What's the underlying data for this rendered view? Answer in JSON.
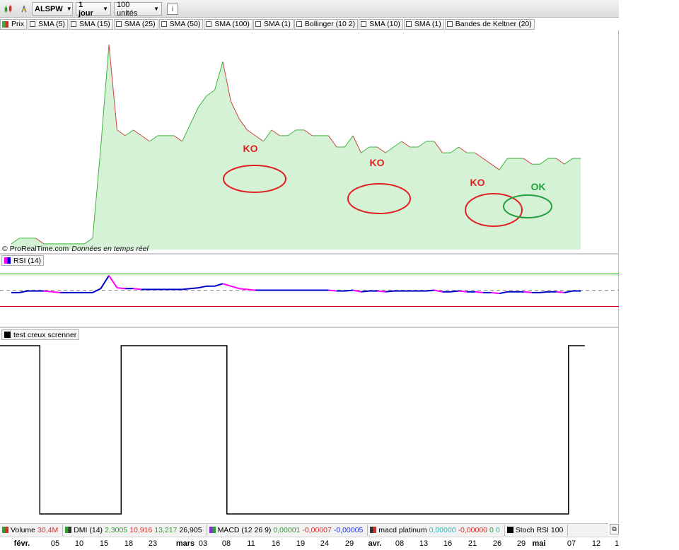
{
  "toolbar": {
    "symbol": "ALSPW",
    "period": "1 jour",
    "units": "100 unités",
    "info_icon": "i"
  },
  "indicators": [
    {
      "label": "Prix",
      "swatch": "#3aa83a"
    },
    {
      "label": "SMA (5)"
    },
    {
      "label": "SMA (15)"
    },
    {
      "label": "SMA (25)"
    },
    {
      "label": "SMA (50)"
    },
    {
      "label": "SMA (100)"
    },
    {
      "label": "SMA (1)"
    },
    {
      "label": "Bollinger (10 2)"
    },
    {
      "label": "SMA (10)"
    },
    {
      "label": "SMA (1)"
    },
    {
      "label": "Bandes de Keltner (20)"
    }
  ],
  "source_note": {
    "brand": "© ProRealTime.com",
    "realtime": "Données en temps réel"
  },
  "rsi_panel": {
    "label": "RSI (14)"
  },
  "test_panel": {
    "label": "test creux screnner"
  },
  "bottom_indicators": {
    "volume": {
      "label": "Volume",
      "value": "30,4M"
    },
    "dmi": {
      "label": "DMI (14)",
      "v1": "2,3005",
      "v2": "10,916",
      "v3": "13,217",
      "v4": "26,905"
    },
    "macd": {
      "label": "MACD (12 26 9)",
      "v1": "0,00001",
      "v2": "-0,00007",
      "v3": "-0,00005"
    },
    "macd_platinum": {
      "label": "macd platinum",
      "v1": "0,00000",
      "v2": "-0,00000",
      "v3": "0",
      "v4": "0"
    },
    "stoch_rsi": {
      "label": "Stoch RSI 100"
    }
  },
  "annotations": [
    {
      "text": "KO",
      "color": "#e02020"
    },
    {
      "text": "KO",
      "color": "#e02020"
    },
    {
      "text": "KO",
      "color": "#e02020"
    },
    {
      "text": "OK",
      "color": "#22a040"
    }
  ],
  "colors": {
    "price_up": "#3cb43c",
    "price_down": "#d04040",
    "area_fill": "#d6f2d6",
    "rsi_up": "#0000cc",
    "rsi_down": "#ff00ff",
    "rsi_upper_line": "#00aa00",
    "rsi_lower_line": "#cc0000",
    "test_line": "#000000"
  },
  "x_ticks": [
    {
      "label": "févr.",
      "bold": true
    },
    {
      "label": "05"
    },
    {
      "label": "10"
    },
    {
      "label": "15"
    },
    {
      "label": "18"
    },
    {
      "label": "23"
    },
    {
      "label": "mars",
      "bold": true
    },
    {
      "label": "03"
    },
    {
      "label": "08"
    },
    {
      "label": "11"
    },
    {
      "label": "16"
    },
    {
      "label": "19"
    },
    {
      "label": "24"
    },
    {
      "label": "29"
    },
    {
      "label": "avr.",
      "bold": true
    },
    {
      "label": "08"
    },
    {
      "label": "13"
    },
    {
      "label": "16"
    },
    {
      "label": "21"
    },
    {
      "label": "26"
    },
    {
      "label": "29"
    },
    {
      "label": "mai",
      "bold": true
    },
    {
      "label": "07"
    },
    {
      "label": "12"
    },
    {
      "label": "1"
    }
  ],
  "chart_data": [
    {
      "type": "line",
      "series": [
        {
          "name": "Prix",
          "values": [
            0.00026,
            0.00027,
            0.00027,
            0.00027,
            0.00026,
            0.00026,
            0.00026,
            0.00026,
            0.00026,
            0.00026,
            0.00027,
            0.00043,
            0.00061,
            0.00046,
            0.00045,
            0.00046,
            0.00045,
            0.00044,
            0.00045,
            0.00045,
            0.00045,
            0.00044,
            0.00047,
            0.0005,
            0.00052,
            0.00053,
            0.00058,
            0.00051,
            0.00048,
            0.00046,
            0.00045,
            0.00044,
            0.00046,
            0.00045,
            0.00045,
            0.00046,
            0.00046,
            0.00045,
            0.00045,
            0.00045,
            0.00043,
            0.00043,
            0.00045,
            0.00042,
            0.00043,
            0.00043,
            0.00042,
            0.00043,
            0.00044,
            0.00043,
            0.00043,
            0.00044,
            0.00044,
            0.00042,
            0.00042,
            0.00043,
            0.00042,
            0.00042,
            0.00041,
            0.0004,
            0.00039,
            0.00041,
            0.00041,
            0.00041,
            0.0004,
            0.0004,
            0.00041,
            0.00041,
            0.0004,
            0.00041,
            0.00041
          ]
        }
      ]
    },
    {
      "type": "line",
      "title": "RSI (14)",
      "series": [
        {
          "name": "RSI (14)",
          "values": [
            47,
            47,
            49,
            49,
            49,
            48,
            47,
            47,
            47,
            47,
            47,
            52,
            68,
            53,
            52,
            52,
            51,
            51,
            51,
            51,
            51,
            51,
            52,
            53,
            55,
            55,
            58,
            55,
            52,
            51,
            50,
            50,
            50,
            50,
            50,
            50,
            50,
            50,
            50,
            50,
            49,
            49,
            50,
            48,
            49,
            49,
            48,
            49,
            49,
            49,
            49,
            49,
            50,
            48,
            48,
            49,
            48,
            48,
            47,
            47,
            46,
            48,
            48,
            48,
            47,
            47,
            48,
            48,
            47,
            49,
            49
          ]
        }
      ],
      "reference_lines": [
        70,
        50,
        30
      ]
    },
    {
      "type": "line",
      "title": "test creux screnner",
      "series": [
        {
          "name": "test creux screnner",
          "values": [
            1,
            1,
            1,
            1,
            0,
            0,
            0,
            0,
            0,
            0,
            0,
            0,
            0,
            0,
            1,
            1,
            1,
            1,
            1,
            1,
            1,
            1,
            1,
            1,
            1,
            1,
            1,
            0,
            0,
            0,
            0,
            0,
            0,
            0,
            0,
            0,
            0,
            0,
            0,
            0,
            0,
            0,
            0,
            0,
            0,
            0,
            0,
            0,
            0,
            0,
            0,
            0,
            0,
            0,
            0,
            0,
            0,
            0,
            0,
            0,
            0,
            0,
            0,
            0,
            0,
            0,
            0,
            0,
            0,
            1,
            1
          ]
        }
      ]
    }
  ]
}
